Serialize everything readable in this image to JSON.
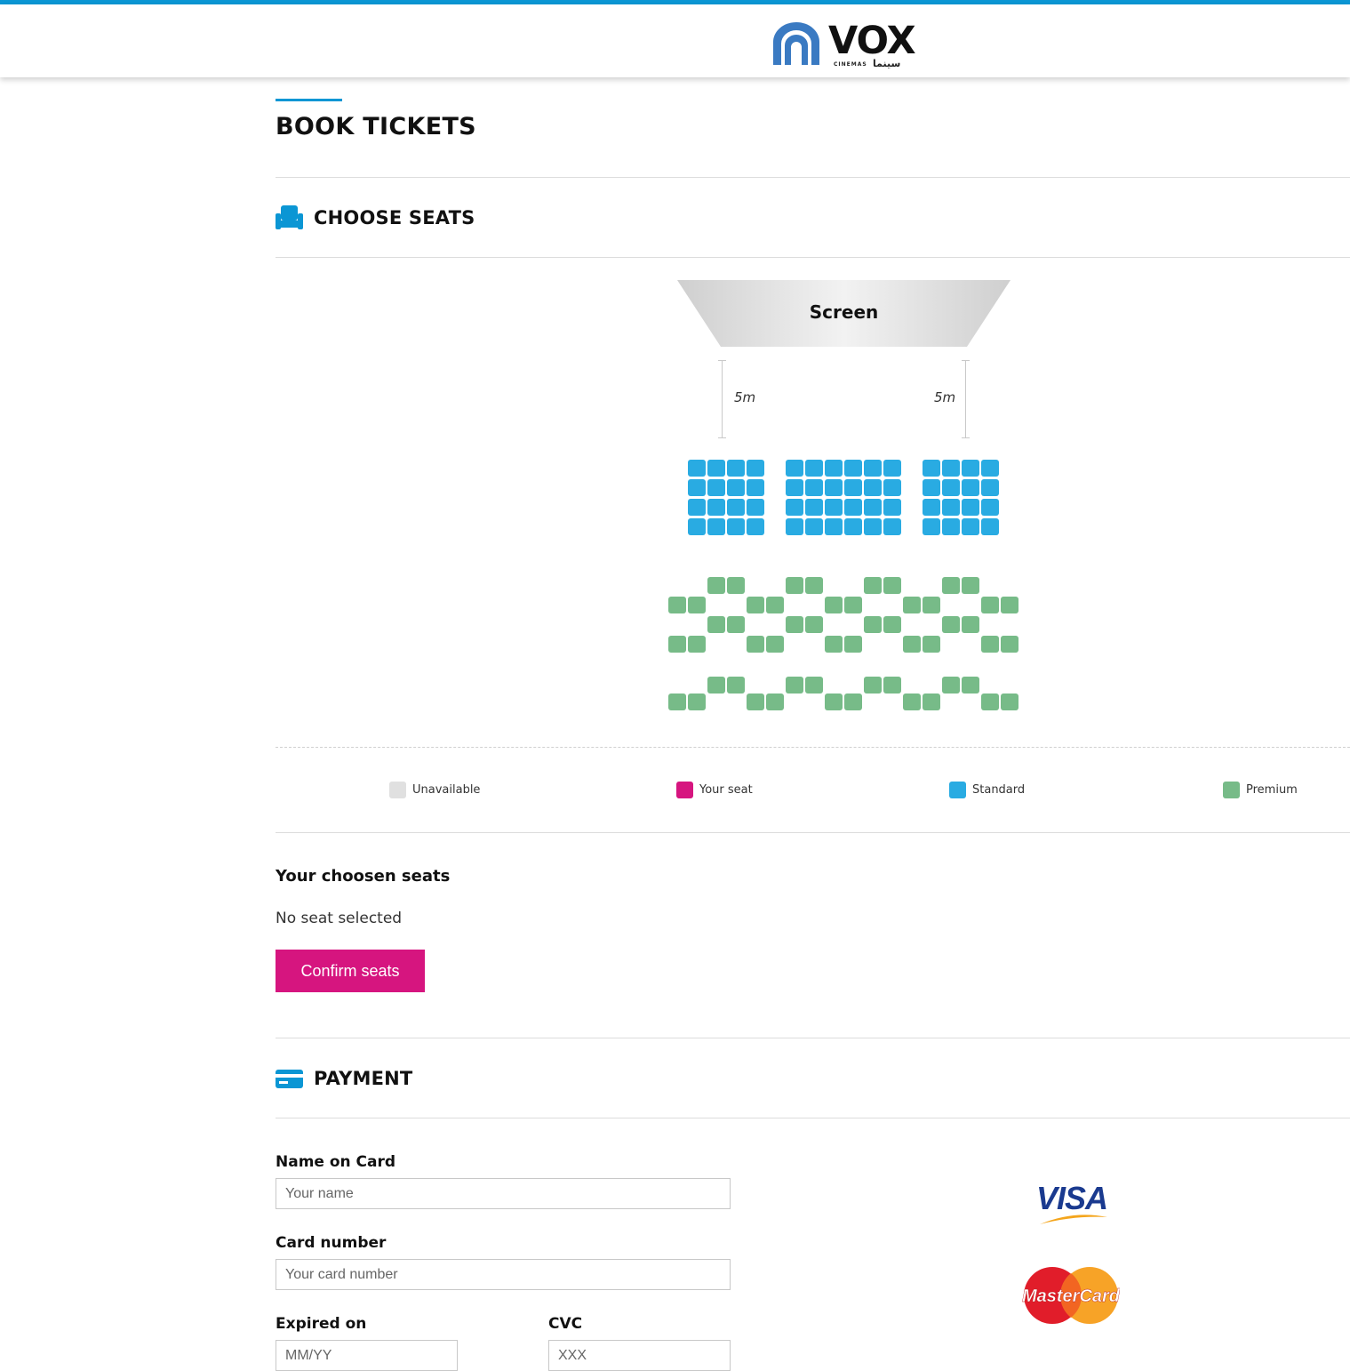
{
  "brand": {
    "name": "VOX",
    "sub": "CINEMAS",
    "arabic": "سينما"
  },
  "page_title": "BOOK TICKETS",
  "choose_seats": {
    "title": "CHOOSE SEATS",
    "screen_label": "Screen",
    "distance_left": "5m",
    "distance_right": "5m"
  },
  "legend": [
    {
      "label": "Unavailable",
      "color": "#e0e0e0"
    },
    {
      "label": "Your seat",
      "color": "#d6157f"
    },
    {
      "label": "Standard",
      "color": "#29abe2"
    },
    {
      "label": "Premium",
      "color": "#77bb88"
    }
  ],
  "seat_map": {
    "standard": {
      "rows": 4,
      "blocks": [
        4,
        6,
        4
      ],
      "color": "#29abe2"
    },
    "premium": {
      "rows": 7,
      "pairs_per_row": 9,
      "color": "#77bb88"
    }
  },
  "chosen": {
    "title": "Your choosen seats",
    "status": "No seat selected",
    "confirm_label": "Confirm seats"
  },
  "payment": {
    "title": "PAYMENT",
    "name_label": "Name on Card",
    "name_placeholder": "Your name",
    "card_label": "Card number",
    "card_placeholder": "Your card number",
    "expiry_label": "Expired on",
    "expiry_placeholder": "MM/YY",
    "cvc_label": "CVC",
    "cvc_placeholder": "XXX",
    "visa_text": "VISA",
    "mastercard_text": "MasterCard"
  },
  "colors": {
    "accent": "#0b96d4",
    "brand_pink": "#d6157f",
    "logo_blue": "#3a7ac2"
  }
}
